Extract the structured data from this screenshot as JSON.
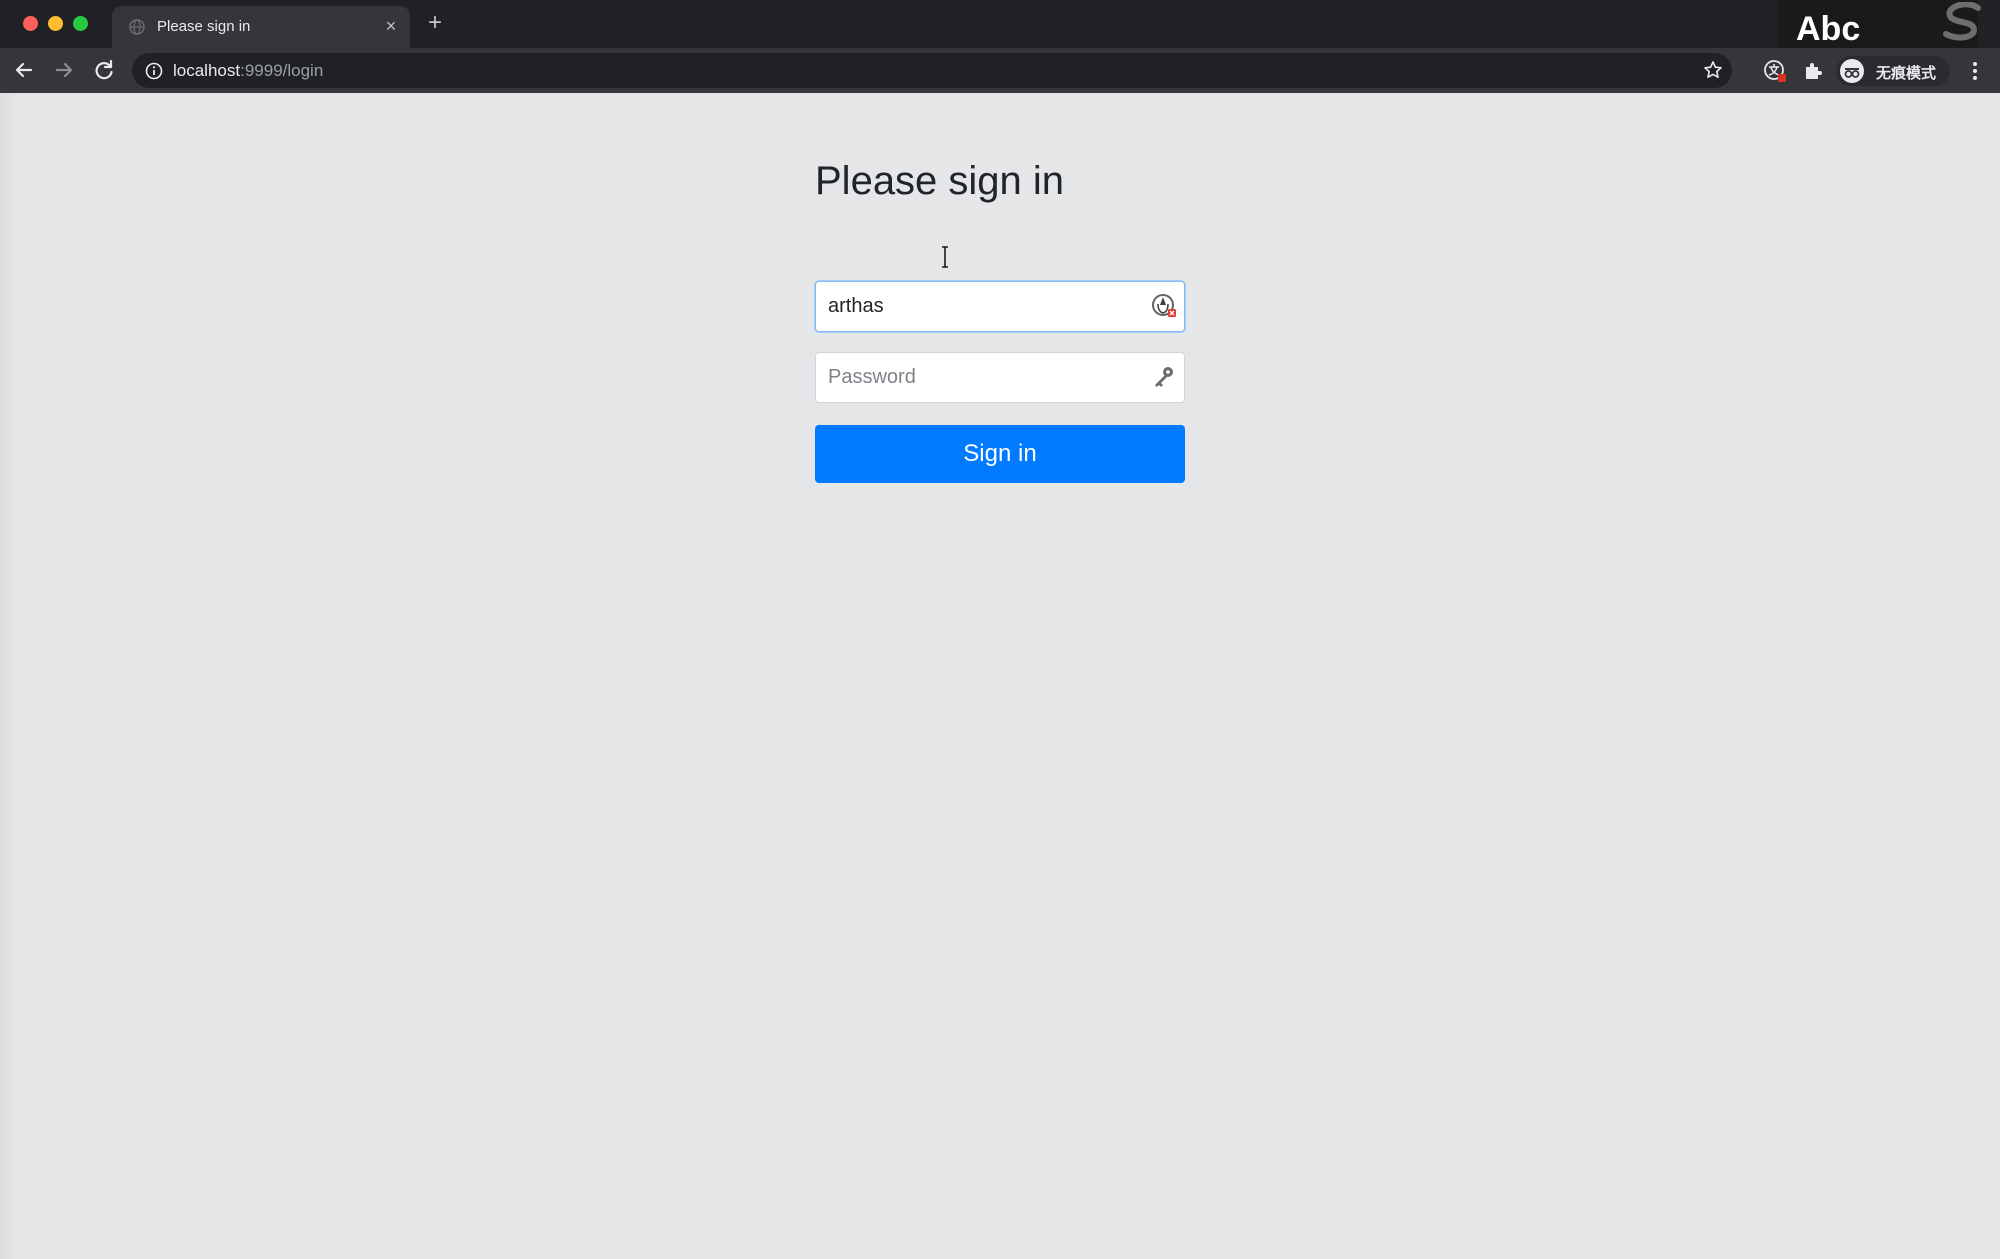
{
  "browser": {
    "tab": {
      "title": "Please sign in",
      "close_glyph": "×",
      "favicon": "globe-icon"
    },
    "new_tab_glyph": "+",
    "address": {
      "host": "localhost",
      "rest": ":9999/login"
    },
    "input_method": "Abc",
    "incognito_label": "无痕模式"
  },
  "form": {
    "heading": "Please sign in",
    "username": {
      "value": "arthas",
      "icon": "password-manager-icon"
    },
    "password": {
      "placeholder": "Password",
      "icon": "key-icon"
    },
    "submit_label": "Sign in"
  },
  "colors": {
    "chrome_dark": "#202124",
    "toolbar": "#35363a",
    "page_bg": "#e5e6e8",
    "primary": "#007bff"
  }
}
